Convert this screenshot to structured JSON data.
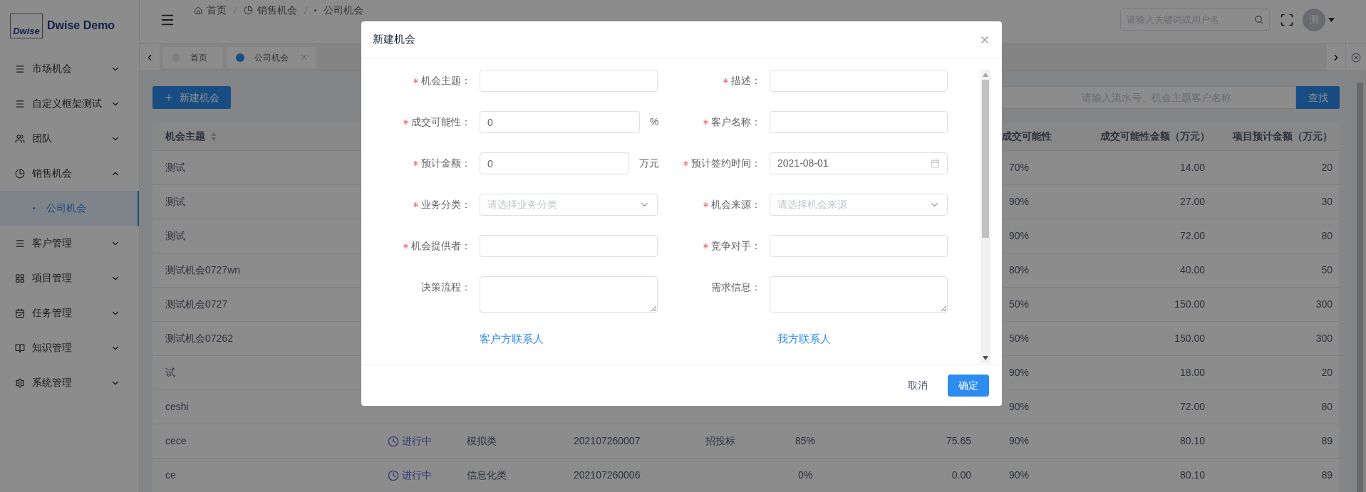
{
  "sidebar": {
    "logo_mark": "Dwise",
    "app_name": "Dwise Demo",
    "items": [
      {
        "label": "市场机会",
        "expanded": false
      },
      {
        "label": "自定义框架测试",
        "expanded": false
      },
      {
        "label": "团队",
        "expanded": false
      },
      {
        "label": "销售机会",
        "expanded": true,
        "children": [
          {
            "label": "公司机会",
            "selected": true
          }
        ]
      },
      {
        "label": "客户管理",
        "expanded": false
      },
      {
        "label": "项目管理",
        "expanded": false
      },
      {
        "label": "任务管理",
        "expanded": false
      },
      {
        "label": "知识管理",
        "expanded": false
      },
      {
        "label": "系统管理",
        "expanded": false
      }
    ]
  },
  "header": {
    "breadcrumb": [
      "首页",
      "销售机会",
      "公司机会"
    ],
    "search": {
      "placeholder": "请输入关键词或用户名"
    },
    "avatar": "测"
  },
  "tabs": [
    {
      "label": "首页",
      "selected": false,
      "closable": false
    },
    {
      "label": "公司机会",
      "selected": true,
      "closable": true
    }
  ],
  "toolbar": {
    "new_button": "新建机会",
    "search": {
      "placeholder": "请输入流水号、机会主题客户名称"
    },
    "search_button": "查找"
  },
  "table": {
    "columns": {
      "subject": "机会主题",
      "deal_probability": "成交可能性",
      "probable_amount": "成交可能性金额（万元）",
      "project_amount": "项目预计金额（万元）"
    },
    "rows": [
      {
        "subject": "测试",
        "deal_probability": "70%",
        "probable_amount": "14.00",
        "project_amount": "20"
      },
      {
        "subject": "测试",
        "deal_probability": "90%",
        "probable_amount": "27.00",
        "project_amount": "30"
      },
      {
        "subject": "测试",
        "deal_probability": "90%",
        "probable_amount": "72.00",
        "project_amount": "80"
      },
      {
        "subject": "测试机会0727wn",
        "deal_probability": "80%",
        "probable_amount": "40.00",
        "project_amount": "50"
      },
      {
        "subject": "测试机会0727",
        "deal_probability": "50%",
        "probable_amount": "150.00",
        "project_amount": "300"
      },
      {
        "subject": "测试机会07262",
        "deal_probability": "50%",
        "probable_amount": "150.00",
        "project_amount": "300"
      },
      {
        "subject": "试",
        "deal_probability": "90%",
        "probable_amount": "18.00",
        "project_amount": "20"
      },
      {
        "subject": "ceshi",
        "deal_probability": "90%",
        "probable_amount": "72.00",
        "project_amount": "80"
      },
      {
        "subject": "cece",
        "column_2": "进行中",
        "column_3": "模拟类",
        "column_4": "202107260007",
        "column_5": "招投标",
        "column_6": "85%",
        "column_7": "75.65",
        "deal_probability": "90%",
        "probable_amount": "80.10",
        "project_amount": "89"
      },
      {
        "subject": "ce",
        "column_2": "进行中",
        "column_3": "信息化类",
        "column_4": "202107260006",
        "column_6": "0%",
        "column_7": "0.00",
        "deal_probability": "90%",
        "probable_amount": "80.10",
        "project_amount": "89"
      }
    ]
  },
  "dialog": {
    "title": "新建机会",
    "rows": [
      [
        {
          "kind": "text",
          "label": "机会主题：",
          "required": true
        },
        {
          "kind": "text",
          "label": "描述：",
          "required": true
        }
      ],
      [
        {
          "kind": "text",
          "label": "成交可能性：",
          "required": true,
          "value": "0",
          "suffix": "%"
        },
        {
          "kind": "text",
          "label": "客户名称：",
          "required": true
        }
      ],
      [
        {
          "kind": "text",
          "label": "预计金额：",
          "required": true,
          "value": "0",
          "suffix": "万元"
        },
        {
          "kind": "date",
          "label": "预计签约时间：",
          "required": true,
          "value": "2021-08-01"
        }
      ],
      [
        {
          "kind": "select",
          "label": "业务分类：",
          "required": true,
          "placeholder": "请选择业务分类"
        },
        {
          "kind": "select",
          "label": "机会来源：",
          "required": true,
          "placeholder": "请选择机会来源"
        }
      ],
      [
        {
          "kind": "text",
          "label": "机会提供者：",
          "required": true
        },
        {
          "kind": "text",
          "label": "竞争对手：",
          "required": true
        }
      ],
      [
        {
          "kind": "textarea",
          "label": "决策流程：",
          "required": false
        },
        {
          "kind": "textarea",
          "label": "需求信息：",
          "required": false
        }
      ]
    ],
    "links": [
      "客户方联系人",
      "我方联系人"
    ],
    "cancel_button": "取消",
    "ok_button": "确定"
  }
}
